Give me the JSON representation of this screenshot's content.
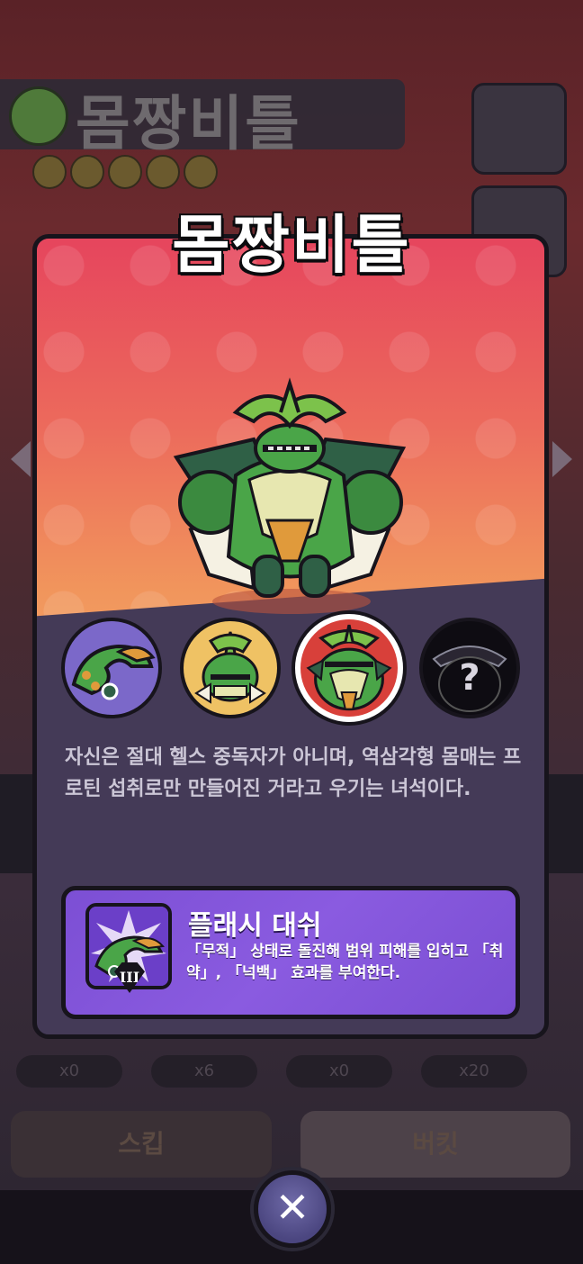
{
  "background": {
    "title": "몸짱비틀",
    "counts": [
      "x0",
      "x6",
      "x0",
      "x20"
    ],
    "left_button_label": "스킵",
    "right_button_label": "버킷"
  },
  "modal": {
    "title": "몸짱비틀",
    "description": "자신은 절대 헬스 중독자가 아니며, 역삼각형 몸매는 프로틴 섭취로만 만들어진 거라고 우기는 녀석이다.",
    "skin_selector": {
      "skins": [
        "skin-1",
        "skin-2",
        "skin-3",
        "skin-locked"
      ],
      "selected_index": 2,
      "locked_symbol": "?"
    },
    "skill": {
      "name": "플래시 대쉬",
      "description": "「무적」 상태로 돌진해 범위 피해를 입히고 「취약」, 「넉백」 효과를 부여한다.",
      "rank": "III"
    }
  },
  "close_button": {
    "symbol": "✕"
  },
  "colors": {
    "header_gradient_top": "#e6455d",
    "header_gradient_bottom": "#f3a86a",
    "panel": "#443a57",
    "skill_card": "#8a5be0"
  }
}
